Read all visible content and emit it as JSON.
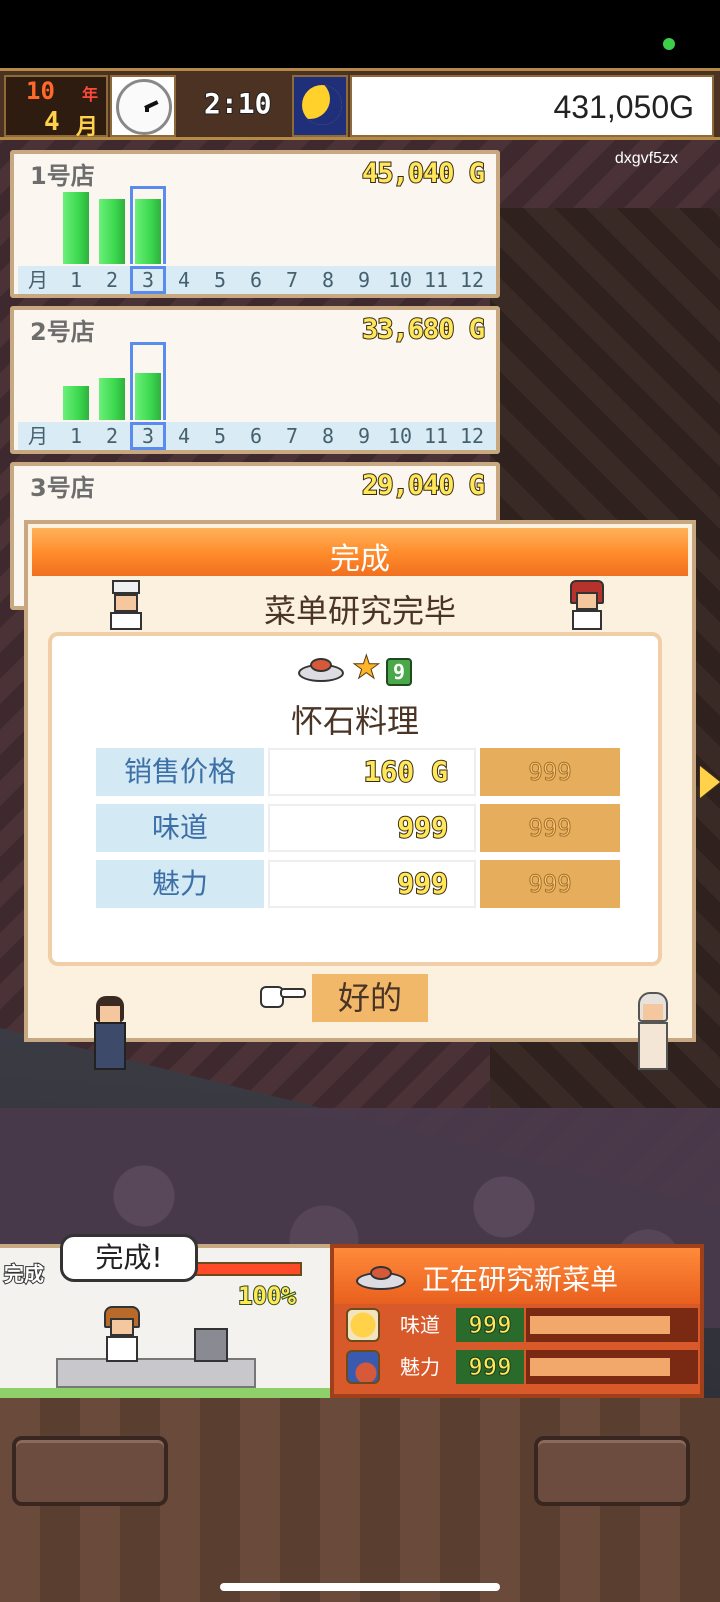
{
  "hud": {
    "year_num": "10",
    "year_unit": "年",
    "month_num": "4",
    "month_unit": "月",
    "time": "2:10",
    "money": "431,050G"
  },
  "player_id": "dxgvf5zx",
  "stores": [
    {
      "name": "1号店",
      "money": "45,040 G",
      "month_label": "月",
      "months": [
        "1",
        "2",
        "3",
        "4",
        "5",
        "6",
        "7",
        "8",
        "9",
        "10",
        "11",
        "12"
      ],
      "values": [
        0.95,
        0.85,
        0.86,
        0,
        0,
        0,
        0,
        0,
        0,
        0,
        0,
        0
      ],
      "selected_month": "3"
    },
    {
      "name": "2号店",
      "money": "33,680 G",
      "month_label": "月",
      "months": [
        "1",
        "2",
        "3",
        "4",
        "5",
        "6",
        "7",
        "8",
        "9",
        "10",
        "11",
        "12"
      ],
      "values": [
        0.45,
        0.55,
        0.62,
        0,
        0,
        0,
        0,
        0,
        0,
        0,
        0,
        0
      ],
      "selected_month": "3"
    },
    {
      "name": "3号店",
      "money": "29,040 G"
    }
  ],
  "dialog": {
    "title": "完成",
    "subtitle": "菜单研究完毕",
    "star_count": "9",
    "dish_name": "怀石料理",
    "stats": [
      {
        "label": "销售价格",
        "value": "160 G",
        "extra": "999"
      },
      {
        "label": "味道",
        "value": "999",
        "extra": "999"
      },
      {
        "label": "魅力",
        "value": "999",
        "extra": "999"
      }
    ],
    "ok_label": "好的"
  },
  "research": {
    "kitchen_label": "完成",
    "speech": "完成!",
    "progress_pct": "100%",
    "progress_value": 1.0,
    "title": "正在研究新菜单",
    "rows": [
      {
        "label": "味道",
        "value": "999",
        "fill": 1.0
      },
      {
        "label": "魅力",
        "value": "999",
        "fill": 1.0
      }
    ]
  },
  "colors": {
    "accent_orange": "#ff8a2a",
    "bar_green": "#3cd84e",
    "gold_text": "#ffe75a"
  }
}
